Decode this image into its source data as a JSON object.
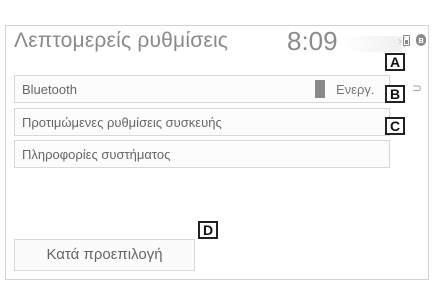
{
  "screen": {
    "title": "Λεπτομερείς ρυθμίσεις",
    "clock": "8:09",
    "status_icons": [
      "phone-icon",
      "bluetooth-icon"
    ]
  },
  "rows": [
    {
      "label": "Bluetooth",
      "state": "Ενεργ.",
      "callout": "A"
    },
    {
      "label": "Προτιμώμενες ρυθμίσεις συσκευής",
      "callout": "B"
    },
    {
      "label": "Πληροφορίες συστήματος",
      "callout": "C"
    }
  ],
  "default_button": {
    "label": "Κατά προεπιλογή",
    "callout": "D"
  },
  "colors": {
    "text": "#8a8a8a",
    "border": "#d8d8d8",
    "callout_border": "#222222"
  }
}
